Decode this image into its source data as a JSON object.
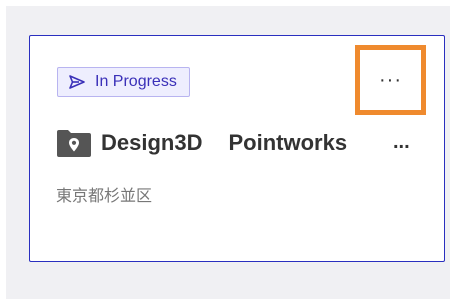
{
  "card": {
    "status": {
      "label": "In Progress",
      "icon": "send-icon",
      "color": "#3a30b8"
    },
    "more_button": {
      "label": "···",
      "icon": "more-horizontal-icon",
      "highlight": "#ef8a2e"
    },
    "title": {
      "icon": "folder-location-icon",
      "part1": "Design3D",
      "part2": "Pointworks",
      "overflow": "..."
    },
    "location": "東京都杉並区"
  }
}
